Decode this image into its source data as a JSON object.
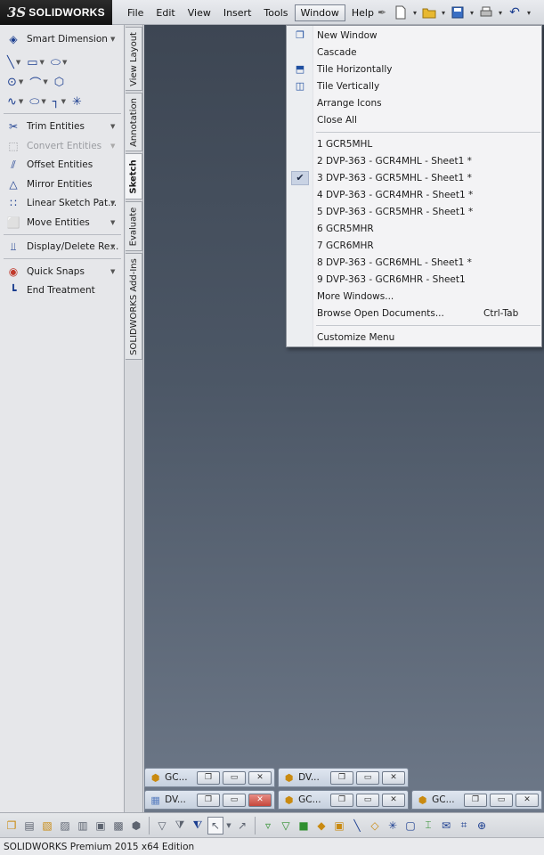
{
  "app": {
    "logo_mark": "3S",
    "logo_text": "SOLIDWORKS"
  },
  "menubar": {
    "items": [
      "File",
      "Edit",
      "View",
      "Insert",
      "Tools",
      "Window",
      "Help"
    ],
    "active": "Window"
  },
  "title_tools": [
    "pin-icon",
    "new-document-icon",
    "open-folder-icon",
    "save-icon",
    "print-icon",
    "undo-icon"
  ],
  "command_manager": {
    "smart_dimension": "Smart Dimension",
    "trim_entities": "Trim Entities",
    "convert_entities": "Convert Entities",
    "offset_entities": "Offset Entities",
    "mirror_entities": "Mirror Entities",
    "linear_sketch_pattern": "Linear Sketch Pat...",
    "move_entities": "Move Entities",
    "display_delete_relations": "Display/Delete Re...",
    "quick_snaps": "Quick Snaps",
    "end_treatment": "End Treatment"
  },
  "vertical_tabs": {
    "view_layout": "View Layout",
    "annotation": "Annotation",
    "sketch": "Sketch",
    "evaluate": "Evaluate",
    "addins": "SOLIDWORKS Add-Ins",
    "active": "Sketch"
  },
  "window_menu": {
    "new_window": "New Window",
    "cascade": "Cascade",
    "tile_horizontally": "Tile Horizontally",
    "tile_vertically": "Tile Vertically",
    "arrange_icons": "Arrange Icons",
    "close_all": "Close All",
    "documents": [
      "1 GCR5MHL",
      "2 DVP-363 - GCR4MHL - Sheet1 *",
      "3 DVP-363 - GCR5MHL - Sheet1 *",
      "4 DVP-363 - GCR4MHR - Sheet1 *",
      "5 DVP-363 - GCR5MHR - Sheet1 *",
      "6 GCR5MHR",
      "7 GCR6MHR",
      "8 DVP-363 - GCR6MHL - Sheet1 *",
      "9 DVP-363 - GCR6MHR - Sheet1"
    ],
    "checked_document": "3 DVP-363 - GCR5MHL - Sheet1 *",
    "more_windows": "More Windows...",
    "browse_open_documents": "Browse Open Documents...",
    "browse_shortcut": "Ctrl-Tab",
    "customize_menu": "Customize Menu"
  },
  "minimized_windows": [
    {
      "title": "GC...",
      "type": "part"
    },
    {
      "title": "DV...",
      "type": "drawing"
    },
    {
      "title": "DV...",
      "type": "drawing"
    },
    {
      "title": "GC...",
      "type": "part"
    },
    {
      "title": "GC...",
      "type": "part"
    }
  ],
  "status_bar": {
    "text": "SOLIDWORKS Premium 2015 x64 Edition"
  },
  "colors": {
    "accent": "#1a3d8f",
    "graphics_top": "#3d4653",
    "graphics_bottom": "#6d7888",
    "close_red": "#c4463b"
  }
}
